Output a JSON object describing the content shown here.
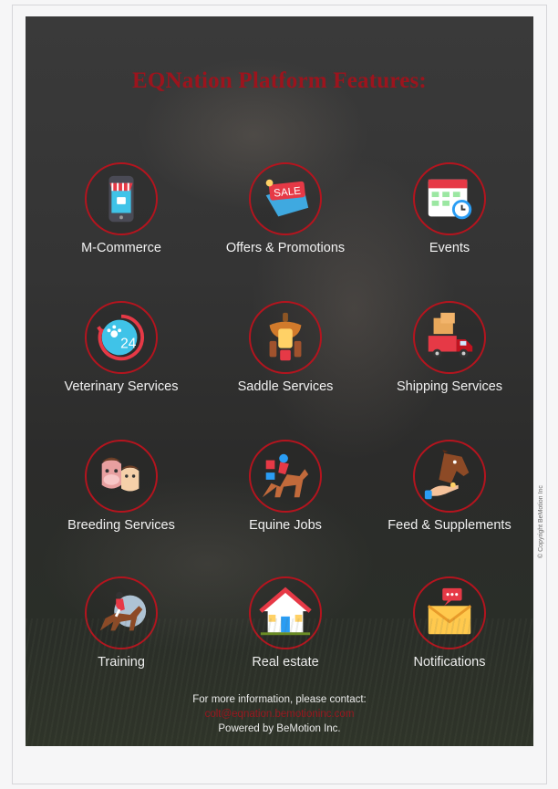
{
  "title": "EQNation Platform Features:",
  "features": [
    {
      "label": "M-Commerce",
      "icon": "mobile-shop-icon"
    },
    {
      "label": "Offers & Promotions",
      "icon": "sale-tag-icon"
    },
    {
      "label": "Events",
      "icon": "calendar-icon"
    },
    {
      "label": "Veterinary Services",
      "icon": "paw-24-icon"
    },
    {
      "label": "Saddle Services",
      "icon": "saddle-icon"
    },
    {
      "label": "Shipping Services",
      "icon": "delivery-truck-icon"
    },
    {
      "label": "Breeding Services",
      "icon": "horse-family-icon"
    },
    {
      "label": "Equine Jobs",
      "icon": "jockey-icon"
    },
    {
      "label": "Feed & Supplements",
      "icon": "horse-feed-icon"
    },
    {
      "label": "Training",
      "icon": "rider-icon"
    },
    {
      "label": "Real estate",
      "icon": "house-icon"
    },
    {
      "label": "Notifications",
      "icon": "envelope-message-icon"
    }
  ],
  "footer": {
    "contact": "For more information, please contact:",
    "email": "colt@eqnation.bemotioninc.com",
    "powered": "Powered by BeMotion Inc."
  },
  "copyright": "© Copyright BeMotion Inc",
  "colors": {
    "accent": "#9c141d",
    "ring": "#b5141e",
    "text": "#f2f2f2"
  }
}
